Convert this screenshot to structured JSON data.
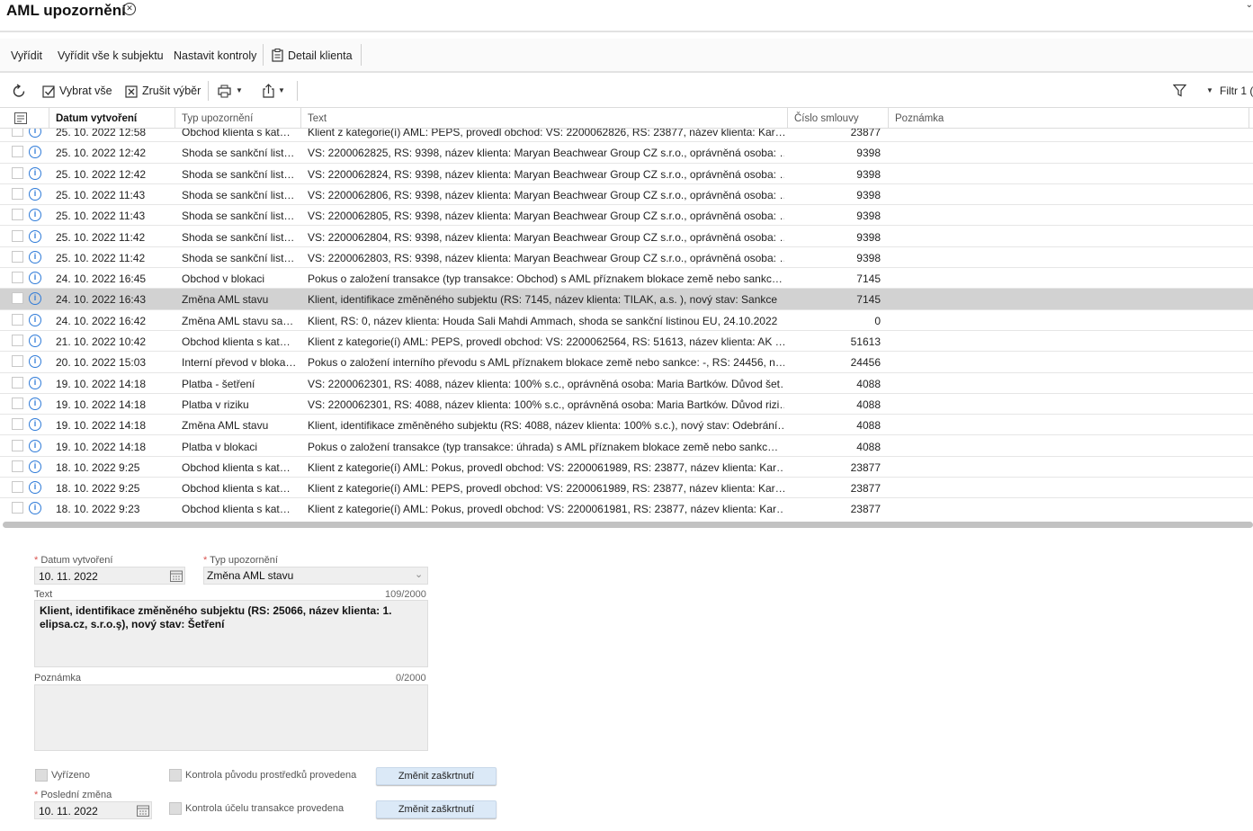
{
  "window": {
    "title": "AML upozornění"
  },
  "actions": {
    "resolve": "Vyřídit",
    "resolve_all": "Vyřídit vše k subjektu",
    "set_checks": "Nastavit kontroly",
    "client_detail": "Detail klienta"
  },
  "toolbar": {
    "select_all": "Vybrat vše",
    "cancel_selection": "Zrušit výběr",
    "filter": "Filtr 1 ("
  },
  "grid": {
    "columns": {
      "date": "Datum vytvoření",
      "type": "Typ upozornění",
      "text": "Text",
      "contract": "Číslo smlouvy",
      "note": "Poznámka"
    },
    "rows": [
      {
        "date": "25. 10. 2022 12:58",
        "type": "Obchod klienta s kat…",
        "text": "Klient z kategorie(í) AML: PEPS, provedl obchod: VS: 2200062826, RS: 23877, název klienta: Kar…",
        "contract": "23877"
      },
      {
        "date": "25. 10. 2022 12:42",
        "type": "Shoda se sankční list…",
        "text": "VS: 2200062825, RS: 9398, název klienta: Maryan Beachwear Group CZ s.r.o., oprávněná osoba: …",
        "contract": "9398"
      },
      {
        "date": "25. 10. 2022 12:42",
        "type": "Shoda se sankční list…",
        "text": "VS: 2200062824, RS: 9398, název klienta: Maryan Beachwear Group CZ s.r.o., oprávněná osoba: …",
        "contract": "9398"
      },
      {
        "date": "25. 10. 2022 11:43",
        "type": "Shoda se sankční list…",
        "text": "VS: 2200062806, RS: 9398, název klienta: Maryan Beachwear Group CZ s.r.o., oprávněná osoba: …",
        "contract": "9398"
      },
      {
        "date": "25. 10. 2022 11:43",
        "type": "Shoda se sankční list…",
        "text": "VS: 2200062805, RS: 9398, název klienta: Maryan Beachwear Group CZ s.r.o., oprávněná osoba: …",
        "contract": "9398"
      },
      {
        "date": "25. 10. 2022 11:42",
        "type": "Shoda se sankční list…",
        "text": "VS: 2200062804, RS: 9398, název klienta: Maryan Beachwear Group CZ s.r.o., oprávněná osoba: …",
        "contract": "9398"
      },
      {
        "date": "25. 10. 2022 11:42",
        "type": "Shoda se sankční list…",
        "text": "VS: 2200062803, RS: 9398, název klienta: Maryan Beachwear Group CZ s.r.o., oprávněná osoba: …",
        "contract": "9398"
      },
      {
        "date": "24. 10. 2022 16:45",
        "type": "Obchod v blokaci",
        "text": "Pokus o založení transakce (typ transakce: Obchod) s AML příznakem blokace země nebo sankc…",
        "contract": "7145"
      },
      {
        "date": "24. 10. 2022 16:43",
        "type": "Změna AML stavu",
        "text": "Klient, identifikace změněného subjektu (RS: 7145, název klienta: TILAK, a.s. ), nový stav: Sankce",
        "contract": "7145",
        "selected": true
      },
      {
        "date": "24. 10. 2022 16:42",
        "type": "Změna AML stavu sa…",
        "text": "Klient, RS: 0, název klienta: Houda Sali Mahdi Ammach, shoda se sankční listinou EU, 24.10.2022",
        "contract": "0"
      },
      {
        "date": "21. 10. 2022 10:42",
        "type": "Obchod klienta s kat…",
        "text": "Klient z kategorie(í) AML: PEPS, provedl obchod: VS: 2200062564, RS: 51613, název klienta: AK …",
        "contract": "51613"
      },
      {
        "date": "20. 10. 2022 15:03",
        "type": "Interní převod v bloka…",
        "text": "Pokus o založení interního převodu s AML příznakem blokace země nebo sankce: -, RS: 24456, n…",
        "contract": "24456"
      },
      {
        "date": "19. 10. 2022 14:18",
        "type": "Platba - šetření",
        "text": "VS: 2200062301, RS: 4088, název klienta: 100% s.c., oprávněná osoba: Maria Bartków. Důvod šet…",
        "contract": "4088"
      },
      {
        "date": "19. 10. 2022 14:18",
        "type": "Platba v riziku",
        "text": "VS: 2200062301, RS: 4088, název klienta: 100% s.c., oprávněná osoba: Maria Bartków. Důvod rizi…",
        "contract": "4088"
      },
      {
        "date": "19. 10. 2022 14:18",
        "type": "Změna AML stavu",
        "text": "Klient, identifikace změněného subjektu (RS: 4088, název klienta: 100% s.c.), nový stav: Odebrání…",
        "contract": "4088"
      },
      {
        "date": "19. 10. 2022 14:18",
        "type": "Platba v blokaci",
        "text": "Pokus o založení transakce (typ transakce: úhrada) s AML příznakem blokace země nebo sankc…",
        "contract": "4088"
      },
      {
        "date": "18. 10. 2022 9:25",
        "type": "Obchod klienta s kat…",
        "text": "Klient z kategorie(í) AML: Pokus, provedl obchod: VS: 2200061989, RS: 23877, název klienta: Kar…",
        "contract": "23877"
      },
      {
        "date": "18. 10. 2022 9:25",
        "type": "Obchod klienta s kat…",
        "text": "Klient z kategorie(í) AML: PEPS, provedl obchod: VS: 2200061989, RS: 23877, název klienta: Kar…",
        "contract": "23877"
      },
      {
        "date": "18. 10. 2022 9:23",
        "type": "Obchod klienta s kat…",
        "text": "Klient z kategorie(í) AML: Pokus, provedl obchod: VS: 2200061981, RS: 23877, název klienta: Kar…",
        "contract": "23877"
      }
    ]
  },
  "form": {
    "date_label": "Datum vytvoření",
    "date_value": "10. 11. 2022",
    "type_label": "Typ upozornění",
    "type_value": "Změna AML stavu",
    "text_label": "Text",
    "text_count": "109/2000",
    "text_value": "Klient, identifikace změněného subjektu (RS: 25066, název klienta: 1. elipsa.cz, s.r.o.ş), nový stav: Šetření",
    "note_label": "Poznámka",
    "note_count": "0/2000",
    "resolved_label": "Vyřízeno",
    "origin_check_label": "Kontrola původu prostředků provedena",
    "purpose_check_label": "Kontrola účelu transakce provedena",
    "change_btn_1": "Změnit zaškrtnutí",
    "change_btn_2": "Změnit zaškrtnutí",
    "last_change_label": "Poslední změna",
    "last_change_value": "10. 11. 2022"
  }
}
